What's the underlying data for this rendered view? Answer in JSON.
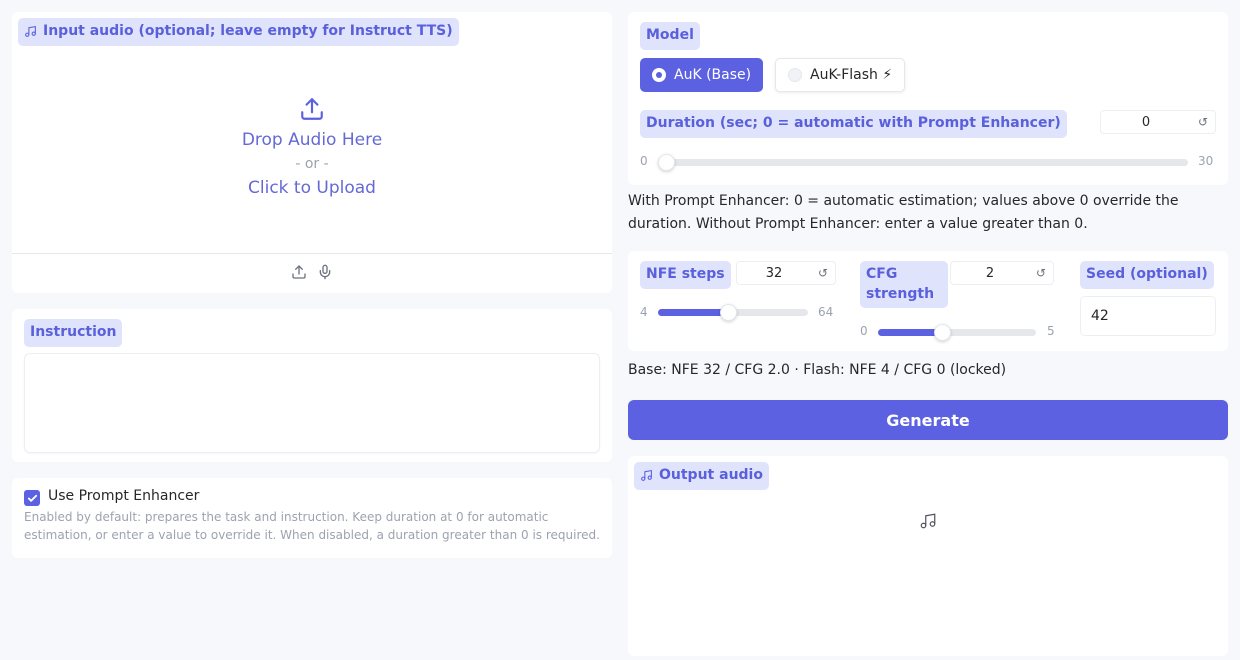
{
  "input_audio": {
    "label": "Input audio (optional; leave empty for Instruct TTS)",
    "drop_text": "Drop Audio Here",
    "or_text": "- or -",
    "click_text": "Click to Upload"
  },
  "instruction": {
    "label": "Instruction",
    "value": ""
  },
  "prompt_enhancer": {
    "label": "Use Prompt Enhancer",
    "checked": true,
    "info": "Enabled by default: prepares the task and instruction. Keep duration at 0 for automatic estimation, or enter a value to override it. When disabled, a duration greater than 0 is required."
  },
  "model": {
    "label": "Model",
    "options": [
      {
        "label": "AuK (Base)",
        "selected": true
      },
      {
        "label": "AuK-Flash ⚡",
        "selected": false
      }
    ]
  },
  "duration": {
    "label": "Duration (sec; 0 = automatic with Prompt Enhancer)",
    "value": "0",
    "min": "0",
    "max": "30",
    "fraction": 0,
    "info": "With Prompt Enhancer: 0 = automatic estimation; values above 0 override the duration. Without Prompt Enhancer: enter a value greater than 0."
  },
  "nfe_steps": {
    "label": "NFE steps",
    "value": "32",
    "min": "4",
    "max": "64",
    "fraction": 0.4667
  },
  "cfg_strength": {
    "label": "CFG strength",
    "value": "2",
    "min": "0",
    "max": "5",
    "fraction": 0.4
  },
  "seed": {
    "label": "Seed (optional)",
    "value": "42"
  },
  "base_note": "Base: NFE 32 / CFG 2.0 · Flash: NFE 4 / CFG 0 (locked)",
  "generate": {
    "label": "Generate"
  },
  "output_audio": {
    "label": "Output audio"
  },
  "colors": {
    "accent": "#5b61e0",
    "tag_bg": "#e0e3fc",
    "page_bg": "#f7f8fb"
  }
}
